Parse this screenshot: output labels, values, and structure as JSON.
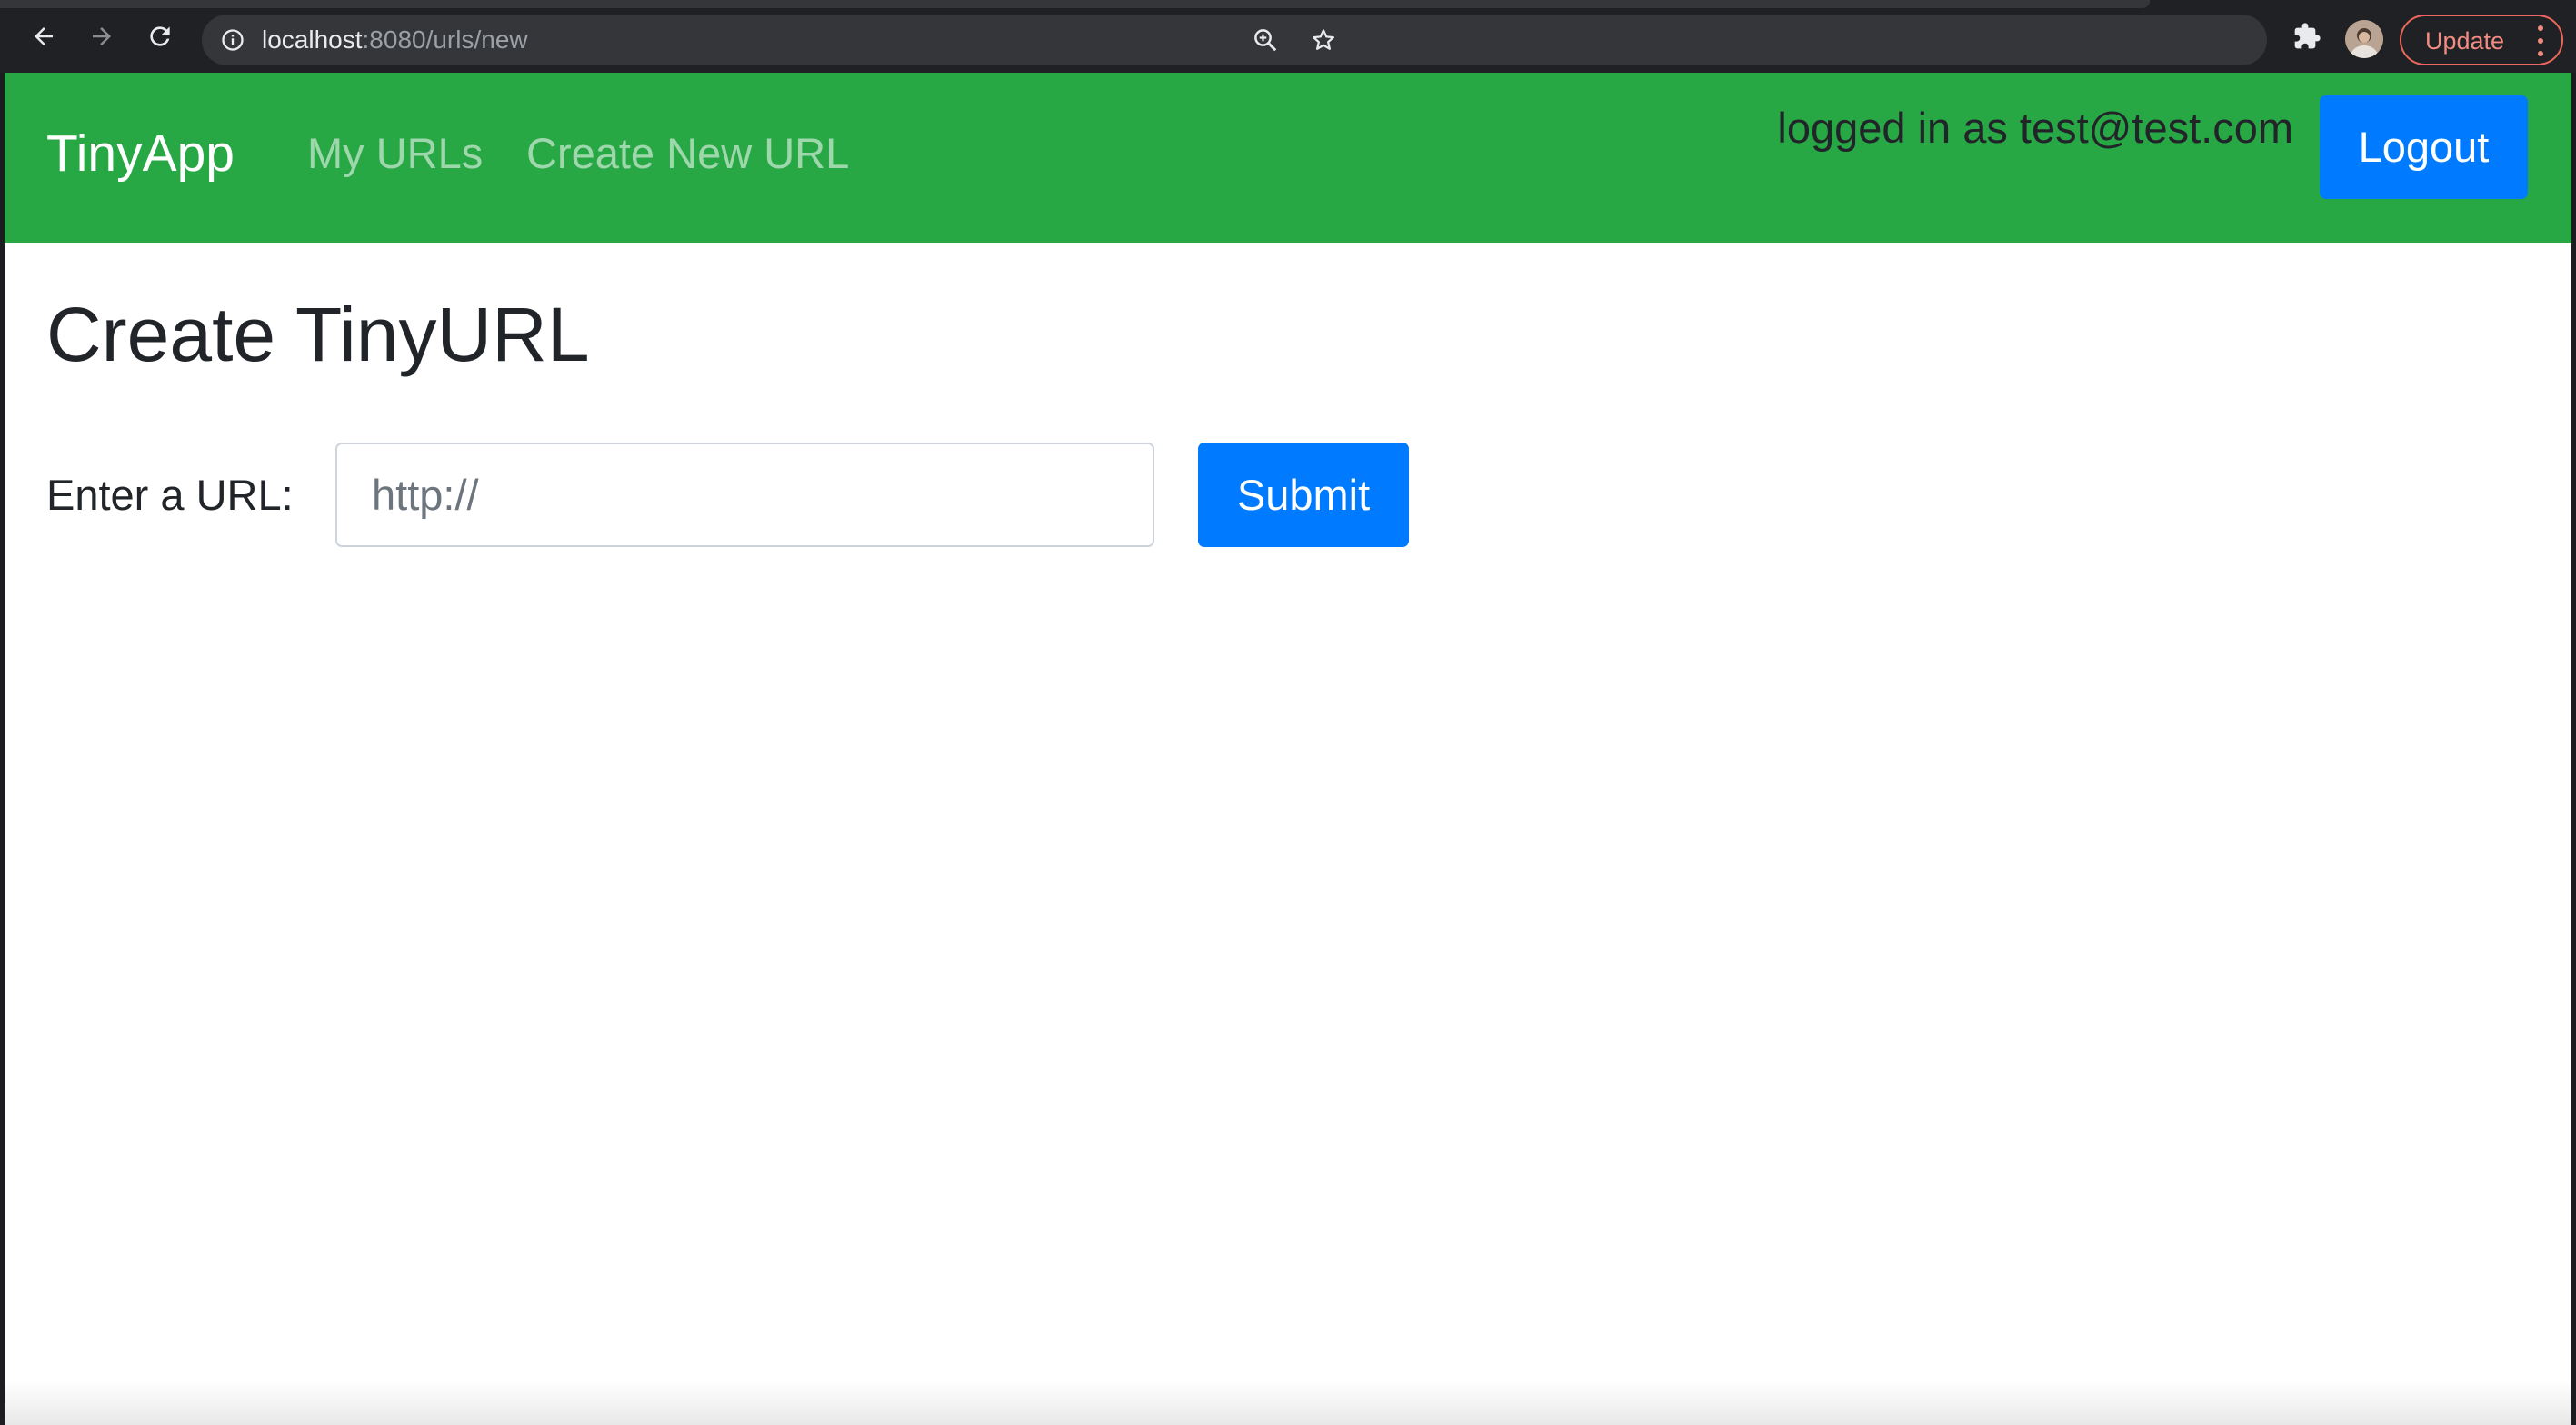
{
  "browser": {
    "url_host": "localhost",
    "url_path": ":8080/urls/new",
    "update_label": "Update",
    "icons": {
      "back": "arrow-left-icon",
      "forward": "arrow-right-icon",
      "reload": "reload-icon",
      "site_info": "info-icon",
      "zoom": "zoom-icon",
      "bookmark": "star-icon",
      "extensions": "puzzle-icon",
      "menu": "more-vert-icon"
    },
    "colors": {
      "update_accent": "#f28b82",
      "chrome_bg": "#202124",
      "omnibox_bg": "#35363a"
    }
  },
  "navbar": {
    "brand": "TinyApp",
    "links": [
      "My URLs",
      "Create New URL"
    ],
    "login_text": "logged in as test@test.com",
    "logout_label": "Logout",
    "colors": {
      "background": "#28a745",
      "button": "#007bff"
    }
  },
  "main": {
    "title": "Create TinyURL",
    "form": {
      "label": "Enter a URL:",
      "placeholder": "http://",
      "value": "",
      "submit_label": "Submit"
    }
  }
}
